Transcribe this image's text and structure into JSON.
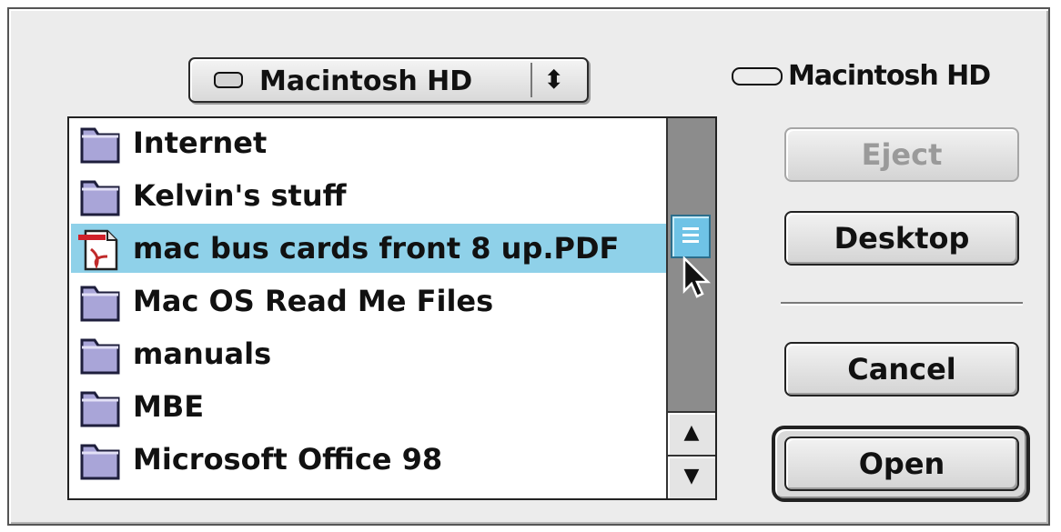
{
  "volume_popup": {
    "selected": "Macintosh HD",
    "icon": "hard-disk-icon",
    "arrow_icon": "up-down-arrows-icon"
  },
  "files": [
    {
      "label": "Internet",
      "icon": "folder-icon",
      "selected": false
    },
    {
      "label": "Kelvin's stuff",
      "icon": "folder-icon",
      "selected": false
    },
    {
      "label": "mac bus cards front 8 up.PDF",
      "icon": "pdf-document-icon",
      "selected": true
    },
    {
      "label": "Mac OS Read Me Files",
      "icon": "folder-icon",
      "selected": false
    },
    {
      "label": "manuals",
      "icon": "folder-icon",
      "selected": false
    },
    {
      "label": "MBE",
      "icon": "folder-icon",
      "selected": false
    },
    {
      "label": "Microsoft Office 98",
      "icon": "folder-icon",
      "selected": false
    }
  ],
  "volume_indicator": {
    "label": "Macintosh HD",
    "icon": "hard-disk-icon"
  },
  "buttons": {
    "eject": "Eject",
    "desktop": "Desktop",
    "cancel": "Cancel",
    "open": "Open"
  },
  "colors": {
    "selection": "#8fd1e9",
    "scroll_thumb": "#6fc3e6",
    "folder": "#a9a5d8"
  }
}
